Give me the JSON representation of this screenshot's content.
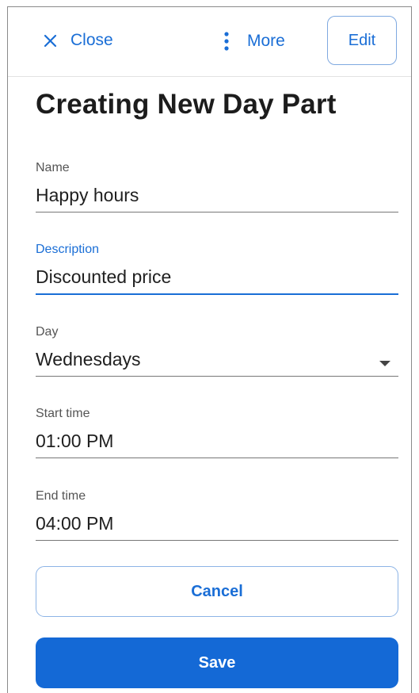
{
  "header": {
    "close_label": "Close",
    "more_label": "More",
    "edit_label": "Edit"
  },
  "title": "Creating New Day Part",
  "form": {
    "name": {
      "label": "Name",
      "value": "Happy hours"
    },
    "description": {
      "label": "Description",
      "value": "Discounted price"
    },
    "day": {
      "label": "Day",
      "value": "Wednesdays"
    },
    "start_time": {
      "label": "Start time",
      "value": "01:00 PM"
    },
    "end_time": {
      "label": "End time",
      "value": "04:00 PM"
    }
  },
  "actions": {
    "cancel_label": "Cancel",
    "save_label": "Save"
  },
  "colors": {
    "accent": "#1a6ed6",
    "primary_button": "#1469d6"
  },
  "icons": [
    "close-icon",
    "more-vertical-icon",
    "dropdown-caret-icon"
  ]
}
